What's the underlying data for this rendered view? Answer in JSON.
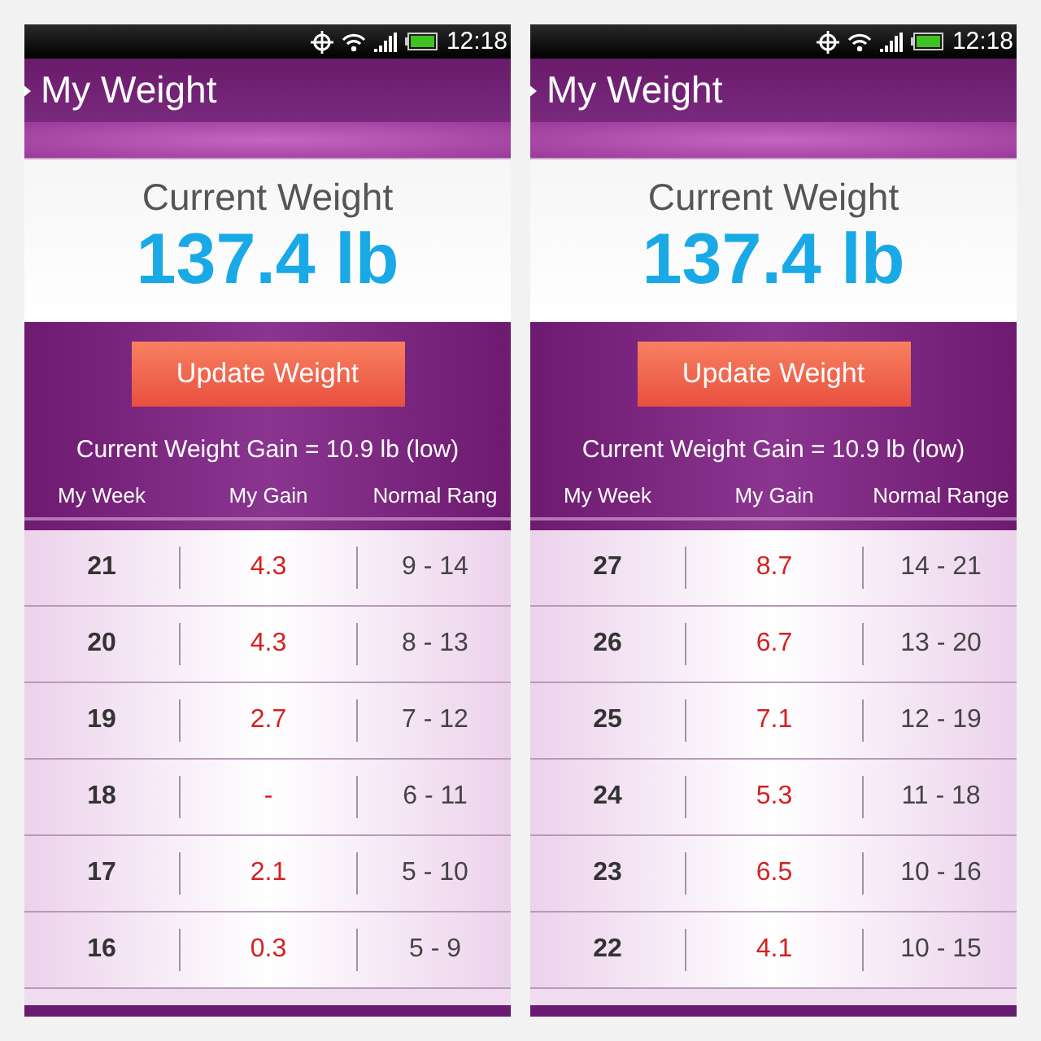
{
  "screens": [
    {
      "status_time": "12:18",
      "title": "My Weight",
      "weight_label": "Current Weight",
      "weight": "137.4 lb",
      "button": "Update Weight",
      "gain_text": "Current Weight Gain = 10.9 lb (low)",
      "columns": [
        "My Week",
        "My Gain",
        "Normal Rang"
      ],
      "rows": [
        {
          "week": "21",
          "gain": "4.3",
          "range": "9 - 14"
        },
        {
          "week": "20",
          "gain": "4.3",
          "range": "8 - 13"
        },
        {
          "week": "19",
          "gain": "2.7",
          "range": "7 - 12"
        },
        {
          "week": "18",
          "gain": "-",
          "range": "6 - 11"
        },
        {
          "week": "17",
          "gain": "2.1",
          "range": "5 - 10"
        },
        {
          "week": "16",
          "gain": "0.3",
          "range": "5 - 9"
        }
      ]
    },
    {
      "status_time": "12:18",
      "title": "My Weight",
      "weight_label": "Current Weight",
      "weight": "137.4 lb",
      "button": "Update Weight",
      "gain_text": "Current Weight Gain = 10.9 lb (low)",
      "columns": [
        "My Week",
        "My Gain",
        "Normal Range"
      ],
      "rows": [
        {
          "week": "27",
          "gain": "8.7",
          "range": "14 - 21"
        },
        {
          "week": "26",
          "gain": "6.7",
          "range": "13 - 20"
        },
        {
          "week": "25",
          "gain": "7.1",
          "range": "12 - 19"
        },
        {
          "week": "24",
          "gain": "5.3",
          "range": "11 - 18"
        },
        {
          "week": "23",
          "gain": "6.5",
          "range": "10 - 16"
        },
        {
          "week": "22",
          "gain": "4.1",
          "range": "10 - 15"
        }
      ]
    }
  ]
}
